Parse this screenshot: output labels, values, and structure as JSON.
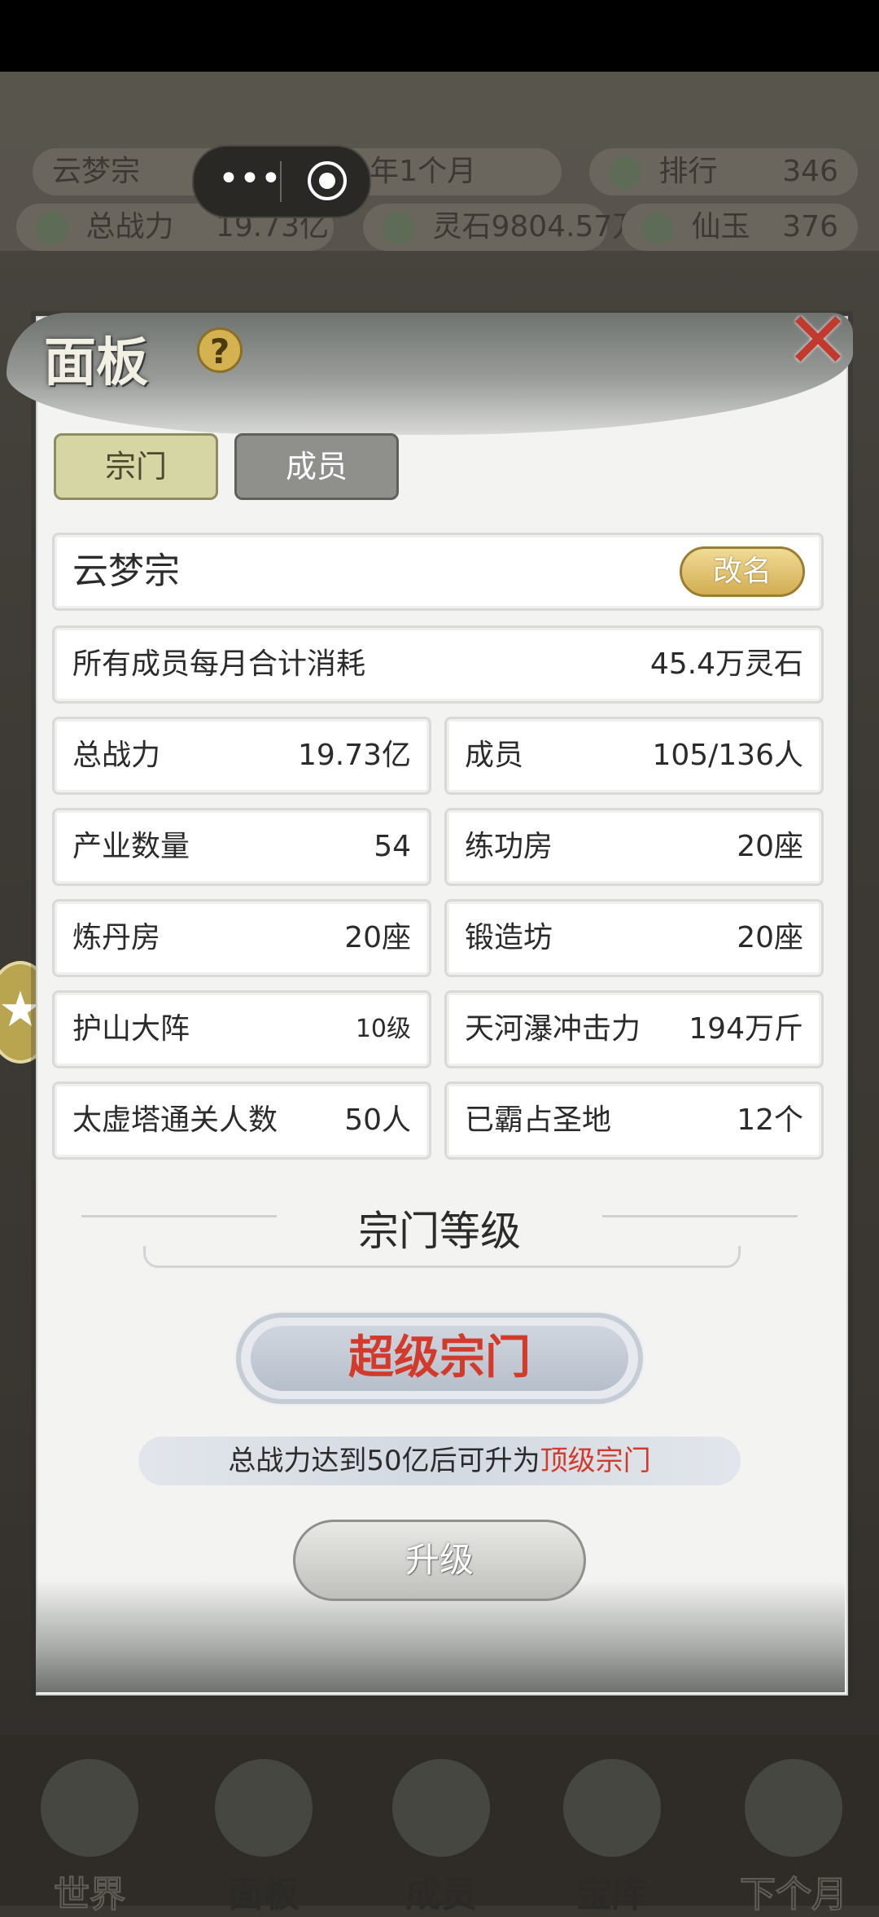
{
  "game_hud": {
    "sect_name": "云梦宗",
    "era": "开世103年1个月",
    "rank_label": "排行",
    "rank_value": "346",
    "power_label": "总战力",
    "power_value": "19.73亿",
    "spirit_stone_label": "灵石",
    "spirit_stone_value": "9804.57万",
    "jade_label": "仙玉",
    "jade_value": "376"
  },
  "mini_program_capsule": {
    "more": "•••"
  },
  "panel": {
    "title": "面板",
    "help": "?",
    "close": "✕",
    "tabs": [
      {
        "label": "宗门",
        "active": true
      },
      {
        "label": "成员",
        "active": false
      }
    ],
    "sect_name": "云梦宗",
    "rename_label": "改名",
    "monthly_cost": {
      "label": "所有成员每月合计消耗",
      "value": "45.4万灵石"
    },
    "stats": [
      {
        "label": "总战力",
        "value": "19.73亿"
      },
      {
        "label": "成员",
        "value": "105/136人"
      },
      {
        "label": "产业数量",
        "value": "54"
      },
      {
        "label": "练功房",
        "value": "20座"
      },
      {
        "label": "炼丹房",
        "value": "20座"
      },
      {
        "label": "锻造坊",
        "value": "20座"
      },
      {
        "label": "护山大阵",
        "value": "10级"
      },
      {
        "label": "天河瀑冲击力",
        "value": "194万斤"
      },
      {
        "label": "太虚塔通关人数",
        "value": "50人"
      },
      {
        "label": "已霸占圣地",
        "value": "12个"
      }
    ],
    "level_section_title": "宗门等级",
    "current_level": "超级宗门",
    "upgrade_note_prefix": "总战力达到50亿后可升为",
    "upgrade_note_target": "顶级宗门",
    "upgrade_button": "升级"
  },
  "bottom_nav": [
    {
      "label": "世界"
    },
    {
      "label": "面板"
    },
    {
      "label": "成员"
    },
    {
      "label": "宝库"
    },
    {
      "label": "下个月"
    }
  ]
}
